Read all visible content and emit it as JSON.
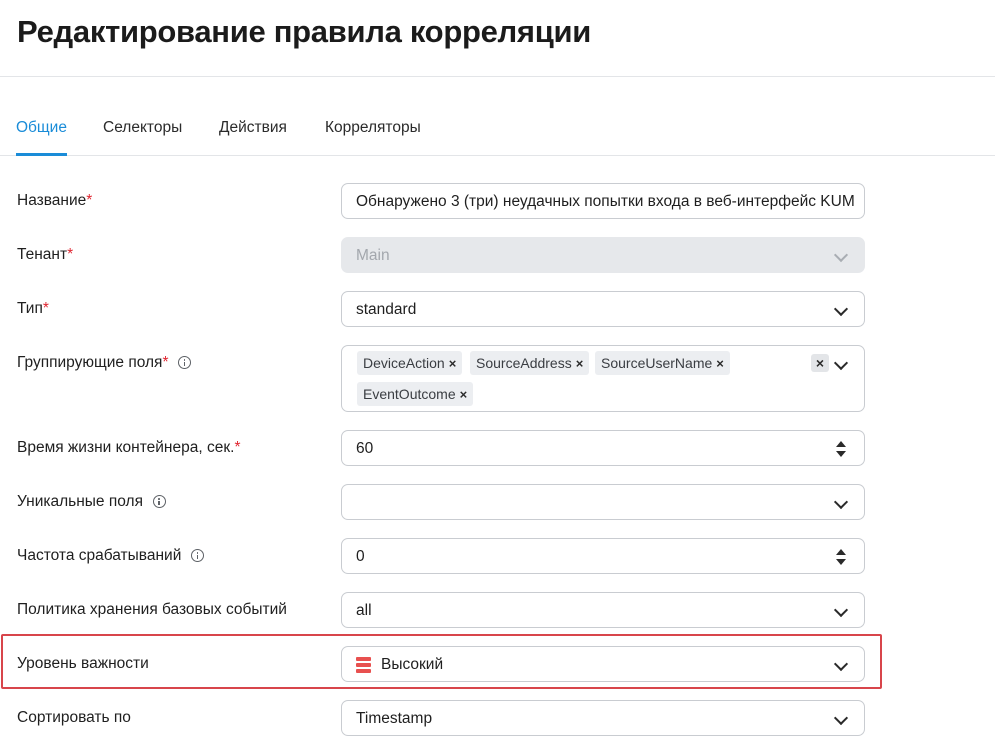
{
  "page_title": "Редактирование правила корреляции",
  "tabs": [
    {
      "label": "Общие",
      "active": true
    },
    {
      "label": "Селекторы",
      "active": false
    },
    {
      "label": "Действия",
      "active": false
    },
    {
      "label": "Корреляторы",
      "active": false
    }
  ],
  "fields": {
    "name": {
      "label": "Название",
      "value": "Обнаружено 3 (три) неудачных попытки входа в веб-интерфейс KUM"
    },
    "tenant": {
      "label": "Тенант",
      "value": "Main"
    },
    "type": {
      "label": "Тип",
      "value": "standard"
    },
    "grouping": {
      "label": "Группирующие поля",
      "chips": [
        "DeviceAction",
        "SourceAddress",
        "SourceUserName",
        "EventOutcome"
      ],
      "chip_remove": "×",
      "clear_all": "×"
    },
    "ttl": {
      "label": "Время жизни контейнера, сек.",
      "value": "60"
    },
    "unique": {
      "label": "Уникальные поля",
      "value": ""
    },
    "rate": {
      "label": "Частота срабатываний",
      "value": "0"
    },
    "storage_policy": {
      "label": "Политика хранения базовых событий",
      "value": "all"
    },
    "severity": {
      "label": "Уровень важности",
      "value": "Высокий",
      "icon": "severity-high-icon",
      "color": "#e8504f"
    },
    "sort_by": {
      "label": "Сортировать по",
      "value": "Timestamp"
    }
  },
  "required_mark": "*",
  "colors": {
    "accent": "#1a8cd8",
    "required": "#e0242f",
    "highlight_border": "#d8454b"
  }
}
